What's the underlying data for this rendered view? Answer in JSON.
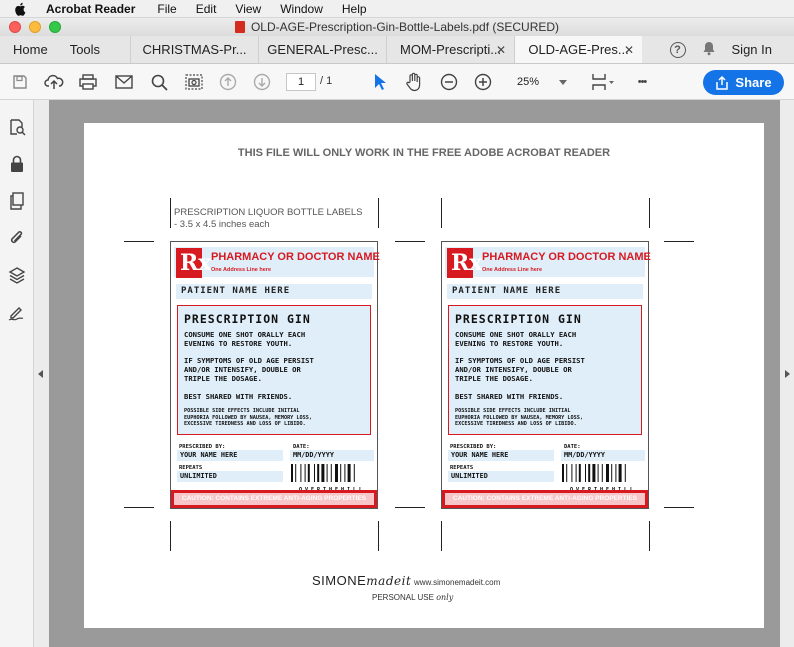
{
  "menubar": {
    "app": "Acrobat Reader",
    "items": [
      "File",
      "Edit",
      "View",
      "Window",
      "Help"
    ]
  },
  "window": {
    "title": "OLD-AGE-Prescription-Gin-Bottle-Labels.pdf (SECURED)"
  },
  "tabs": {
    "home": "Home",
    "tools": "Tools",
    "items": [
      {
        "label": "CHRISTMAS-Pr..."
      },
      {
        "label": "GENERAL-Presc..."
      },
      {
        "label": "MOM-Prescripti..."
      },
      {
        "label": "OLD-AGE-Pres..."
      }
    ],
    "help_glyph": "?",
    "sign_in": "Sign In"
  },
  "toolbar": {
    "page_current": "1",
    "page_total": "/ 1",
    "zoom": "25%",
    "share": "Share",
    "more": "•••"
  },
  "document": {
    "notice": "THIS FILE WILL ONLY WORK IN THE FREE ADOBE ACROBAT READER",
    "caption_line1": "PRESCRIPTION LIQUOR BOTTLE LABELS",
    "caption_line2": "- 3.5 x 4.5 inches each",
    "brand_main": "SIMONE",
    "brand_script": "madeit",
    "website": "www.simonemadeit.com",
    "personal_use": "PERSONAL USE",
    "personal_script": "only"
  },
  "label": {
    "rx": "Rx",
    "pharmacy": "PHARMACY OR DOCTOR NAME",
    "address": "One Address Line here",
    "patient": "PATIENT NAME HERE",
    "drug": "PRESCRIPTION GIN",
    "dose1": "CONSUME ONE SHOT ORALLY EACH",
    "dose2": "EVENING TO RESTORE YOUTH.",
    "warn1": "IF SYMPTOMS OF OLD AGE PERSIST",
    "warn2": "AND/OR INTENSIFY, DOUBLE OR",
    "warn3": "TRIPLE THE DOSAGE.",
    "share_note": "BEST SHARED WITH FRIENDS.",
    "side1": "POSSIBLE SIDE EFFECTS INCLUDE INITIAL",
    "side2": "EUPHORIA FOLLOWED BY NAUSEA, MEMORY LOSS,",
    "side3": "EXCESSIVE TIREDNESS AND LOSS OF LIBIDO.",
    "prescribed_cap": "PRESCRIBED BY:",
    "prescribed_val": "YOUR NAME HERE",
    "date_cap": "DATE:",
    "date_val": "MM/DD/YYYY",
    "repeats_cap": "REPEATS",
    "repeats_val": "UNLIMITED",
    "barcode_text": "OVERTHEHILL",
    "caution": "CAUTION: CONTAINS EXTREME ANTI-AGING PROPERTIES"
  },
  "colors": {
    "accent": "#d71920",
    "label_fill": "#dfeef9",
    "share_button": "#1473e6"
  }
}
